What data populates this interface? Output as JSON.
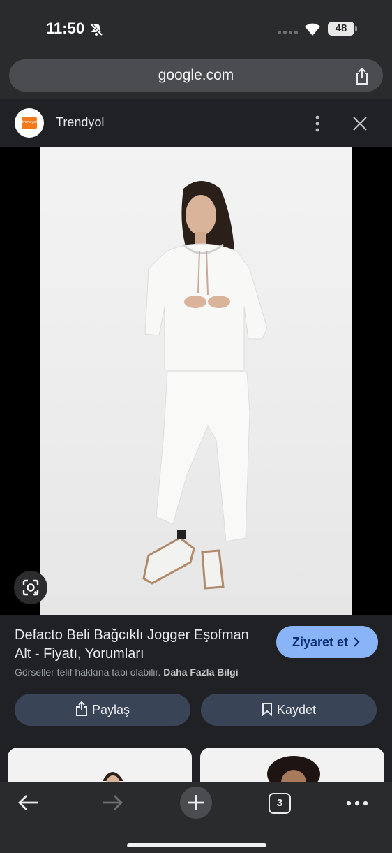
{
  "status_bar": {
    "time": "11:50",
    "battery": "48"
  },
  "url_bar": {
    "url": "google.com"
  },
  "source": {
    "name": "Trendyol",
    "logo_text": "trendyol",
    "logo_color": "#f27a1a"
  },
  "result": {
    "title": "Defacto Beli Bağcıklı Jogger Eşofman Alt - Fiyatı, Yorumları",
    "visit_label": "Ziyaret et",
    "notice": "Görseller telif hakkına tabi olabilir.",
    "notice_link": "Daha Fazla Bilgi",
    "share_label": "Paylaş",
    "save_label": "Kaydet"
  },
  "toolbar": {
    "tab_count": "3"
  },
  "colors": {
    "accent": "#8ab4f8",
    "button_bg": "#394457"
  }
}
